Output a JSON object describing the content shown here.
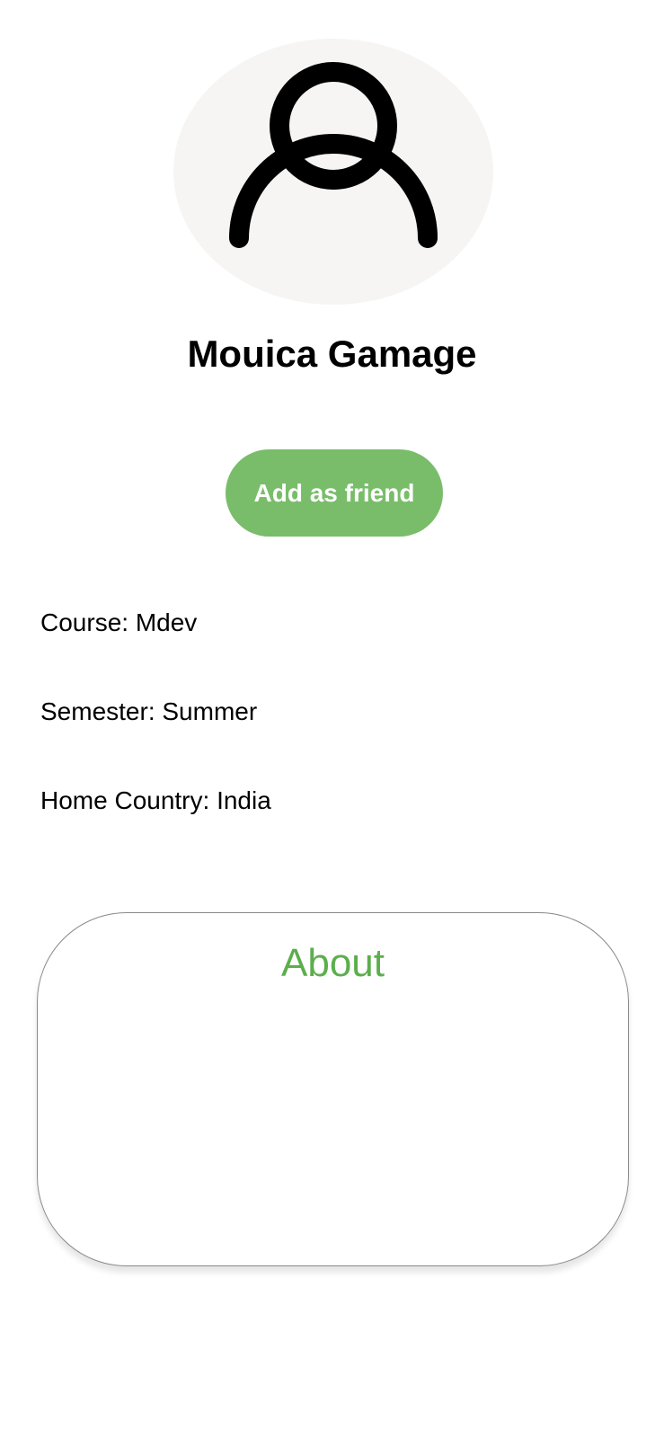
{
  "profile": {
    "avatar_icon": "user-icon",
    "name": "Mouica Gamage"
  },
  "actions": {
    "add_friend_label": "Add as friend"
  },
  "details": {
    "course": "Course: Mdev",
    "semester": "Semester: Summer",
    "home_country": "Home Country: India"
  },
  "about": {
    "title": "About",
    "body": ""
  },
  "colors": {
    "accent": "#79bd6a",
    "about_title": "#5cae4d",
    "avatar_background": "#f6f5f3"
  }
}
